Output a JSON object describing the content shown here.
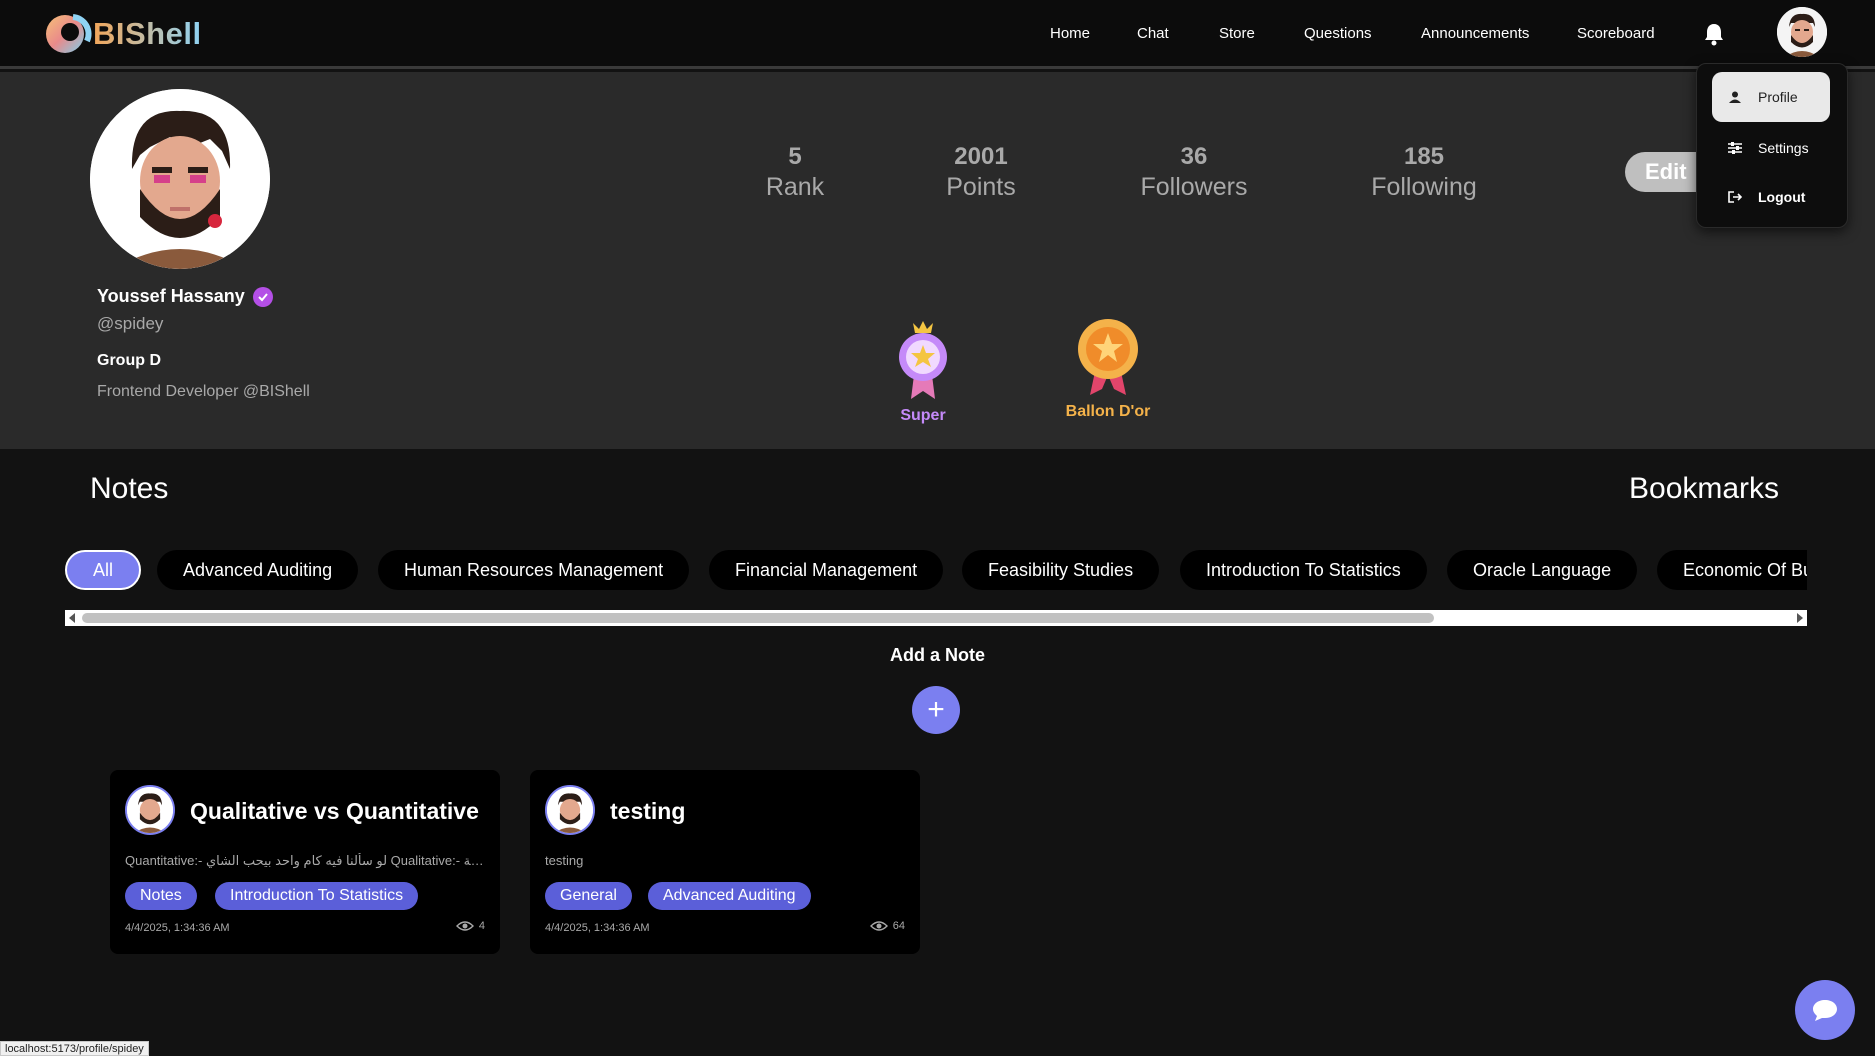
{
  "app": {
    "brand": "BIShell"
  },
  "nav": {
    "links": [
      "Home",
      "Chat",
      "Store",
      "Questions",
      "Announcements",
      "Scoreboard"
    ],
    "notifications_icon": "bell-icon"
  },
  "dropdown": {
    "items": [
      {
        "label": "Profile",
        "icon": "user-icon"
      },
      {
        "label": "Settings",
        "icon": "sliders-icon"
      },
      {
        "label": "Logout",
        "icon": "logout-icon"
      }
    ]
  },
  "profile": {
    "name": "Youssef Hassany",
    "handle": "@spidey",
    "group": "Group D",
    "bio": "Frontend Developer @BIShell",
    "edit_label": "Edit",
    "stats": [
      {
        "value": "5",
        "label": "Rank"
      },
      {
        "value": "2001",
        "label": "Points"
      },
      {
        "value": "36",
        "label": "Followers"
      },
      {
        "value": "185",
        "label": "Following"
      }
    ],
    "badges": [
      {
        "label": "Super",
        "color": "#c58af9"
      },
      {
        "label": "Ballon D'or",
        "color": "#f4b24a"
      }
    ]
  },
  "sections": {
    "notes": "Notes",
    "bookmarks": "Bookmarks"
  },
  "filters": [
    "All",
    "Advanced Auditing",
    "Human Resources Management",
    "Financial Management",
    "Feasibility Studies",
    "Introduction To Statistics",
    "Oracle Language",
    "Economic Of Bu"
  ],
  "add_note": {
    "title": "Add a Note",
    "button": "+"
  },
  "notes": [
    {
      "title": "Qualitative vs Quantitative",
      "desc": "Quantitative:- لو سألنا فيه كام واحد بيحب الشاي Qualitative:- رجالة ...",
      "tags": [
        "Notes",
        "Introduction To Statistics"
      ],
      "date": "4/4/2025, 1:34:36 AM",
      "views": "4"
    },
    {
      "title": "testing",
      "desc": "testing",
      "tags": [
        "General",
        "Advanced Auditing"
      ],
      "date": "4/4/2025, 1:34:36 AM",
      "views": "64"
    }
  ],
  "status_bar": {
    "url": "localhost:5173/profile/spidey"
  },
  "colors": {
    "accent": "#7b7ff0",
    "tag": "#5b5fd9",
    "verified": "#b44fe6"
  }
}
